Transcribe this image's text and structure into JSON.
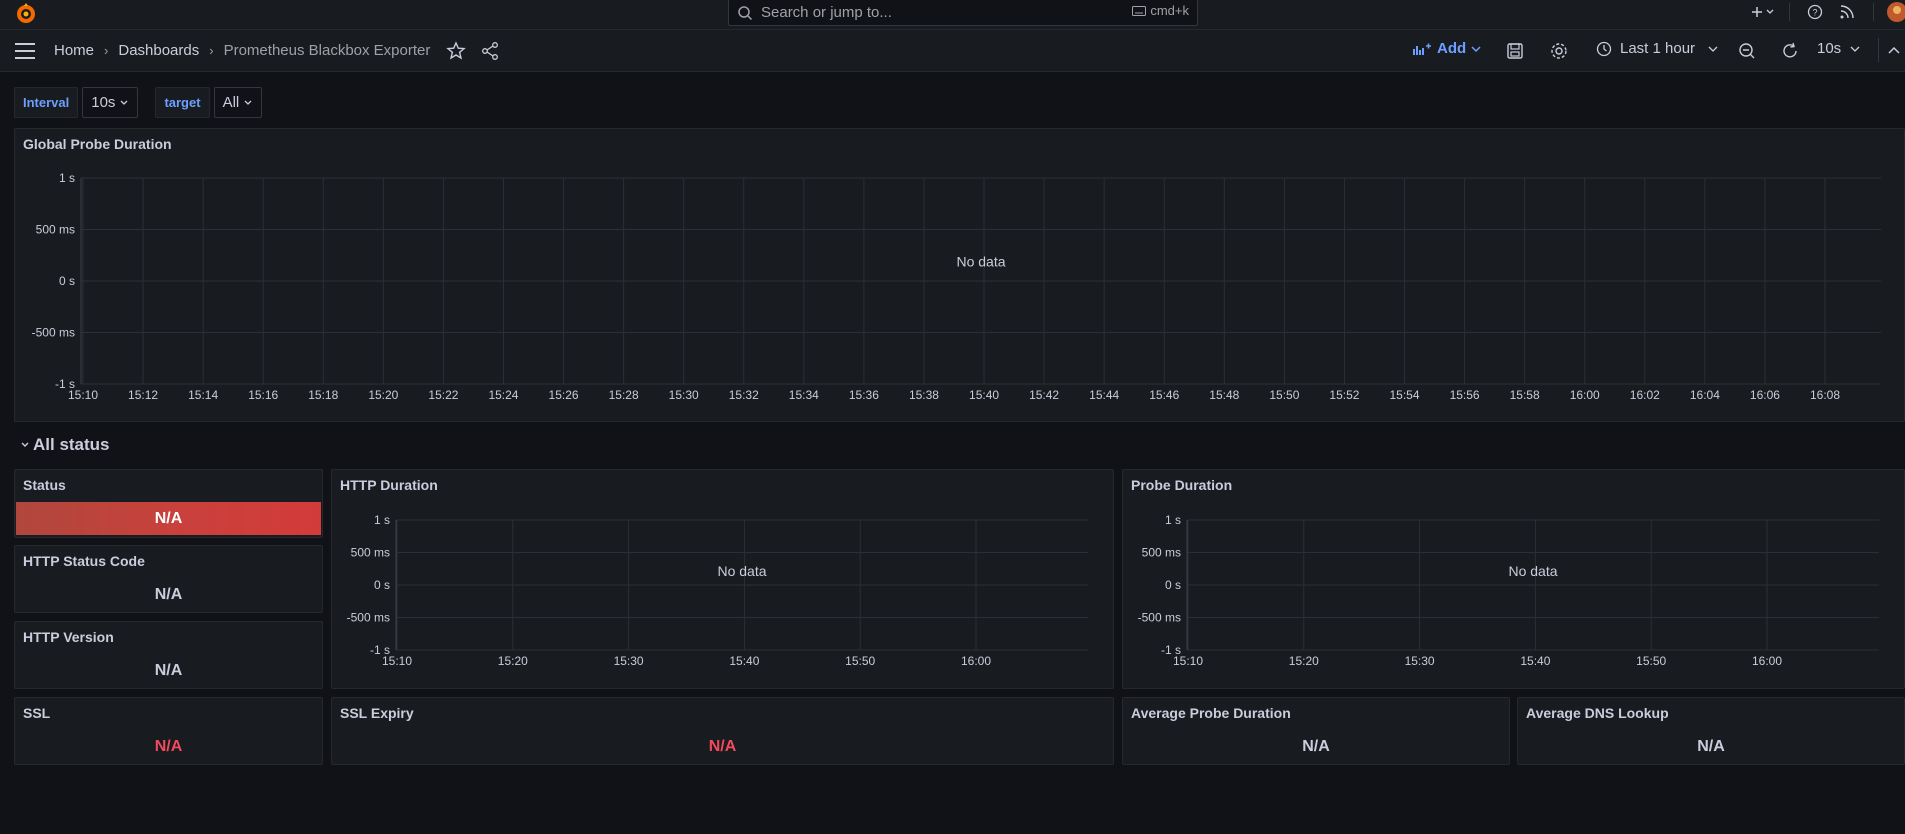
{
  "topbar": {
    "search_placeholder": "Search or jump to...",
    "search_shortcut": "cmd+k"
  },
  "nav": {
    "breadcrumbs": [
      "Home",
      "Dashboards",
      "Prometheus Blackbox Exporter"
    ],
    "add_label": "Add",
    "time_range": "Last 1 hour",
    "refresh_interval": "10s"
  },
  "variables": [
    {
      "label": "Interval",
      "value": "10s"
    },
    {
      "label": "target",
      "value": "All"
    }
  ],
  "row": {
    "title": "All status"
  },
  "panels": {
    "global": {
      "title": "Global Probe Duration",
      "no_data": "No data"
    },
    "status": {
      "title": "Status",
      "value": "N/A"
    },
    "http_status_code": {
      "title": "HTTP Status Code",
      "value": "N/A"
    },
    "http_version": {
      "title": "HTTP Version",
      "value": "N/A"
    },
    "http_duration": {
      "title": "HTTP Duration",
      "no_data": "No data"
    },
    "probe_duration": {
      "title": "Probe Duration",
      "no_data": "No data"
    },
    "ssl": {
      "title": "SSL",
      "value": "N/A"
    },
    "ssl_expiry": {
      "title": "SSL Expiry",
      "value": "N/A"
    },
    "avg_probe": {
      "title": "Average Probe Duration",
      "value": "N/A"
    },
    "avg_dns": {
      "title": "Average DNS Lookup",
      "value": "N/A"
    }
  },
  "colors": {
    "background": "#111217",
    "panel": "#181b1f",
    "accent": "#6e9fff",
    "status_red": "#d33b3a",
    "text_red": "#f2495c"
  },
  "chart_data": [
    {
      "type": "line",
      "title": "Global Probe Duration",
      "yticks": [
        "1 s",
        "500 ms",
        "0 s",
        "-500 ms",
        "-1 s"
      ],
      "ylim": [
        -1,
        1
      ],
      "x": [
        "15:10",
        "15:12",
        "15:14",
        "15:16",
        "15:18",
        "15:20",
        "15:22",
        "15:24",
        "15:26",
        "15:28",
        "15:30",
        "15:32",
        "15:34",
        "15:36",
        "15:38",
        "15:40",
        "15:42",
        "15:44",
        "15:46",
        "15:48",
        "15:50",
        "15:52",
        "15:54",
        "15:56",
        "15:58",
        "16:00",
        "16:02",
        "16:04",
        "16:06",
        "16:08"
      ],
      "series": []
    },
    {
      "type": "line",
      "title": "HTTP Duration",
      "yticks": [
        "1 s",
        "500 ms",
        "0 s",
        "-500 ms",
        "-1 s"
      ],
      "ylim": [
        -1,
        1
      ],
      "x": [
        "15:10",
        "15:20",
        "15:30",
        "15:40",
        "15:50",
        "16:00"
      ],
      "series": []
    },
    {
      "type": "line",
      "title": "Probe Duration",
      "yticks": [
        "1 s",
        "500 ms",
        "0 s",
        "-500 ms",
        "-1 s"
      ],
      "ylim": [
        -1,
        1
      ],
      "x": [
        "15:10",
        "15:20",
        "15:30",
        "15:40",
        "15:50",
        "16:00"
      ],
      "series": []
    }
  ]
}
